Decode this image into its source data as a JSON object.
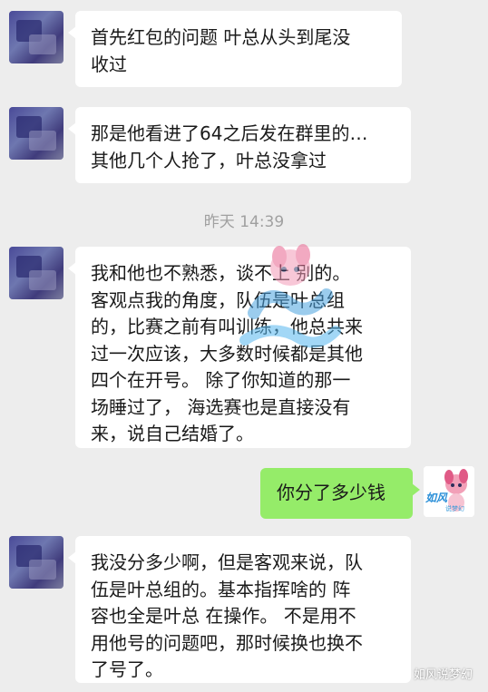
{
  "messages": [
    {
      "side": "left",
      "lines": [
        "首先红包的问题 叶总从头到尾没",
        "收过"
      ]
    },
    {
      "side": "left",
      "lines": [
        "那是他看进了64之后发在群里的…",
        "其他几个人抢了，叶总没拿过"
      ]
    },
    {
      "side": "left",
      "lines": [
        "我和他也不熟悉，谈不上 别的。",
        "客观点我的角度，队伍是叶总组",
        "的，比赛之前有叫训练，他总共来",
        "过一次应该，大多数时候都是其他",
        "四个在开号。   除了你知道的那一",
        "场睡过了，  海选赛也是直接没有",
        "来，说自己结婚了。"
      ]
    },
    {
      "side": "right",
      "lines": [
        "你分了多少钱"
      ]
    },
    {
      "side": "left",
      "lines": [
        "我没分多少啊，但是客观来说，队",
        "伍是叶总组的。基本指挥啥的 阵",
        "容也全是叶总 在操作。  不是用不",
        "用他号的问题吧，那时候换也换不",
        "了号了。"
      ]
    }
  ],
  "timestamp": "昨天 14:39",
  "self_avatar": {
    "icon": "cartoon-avatar-icon",
    "logo_text": "如风",
    "logo_sub": "说梦幻"
  },
  "watermark": {
    "icon": "wechat-icon",
    "text": "如风说梦幻"
  },
  "colors": {
    "background": "#ededed",
    "received_bubble": "#ffffff",
    "sent_bubble": "#95ec69"
  }
}
